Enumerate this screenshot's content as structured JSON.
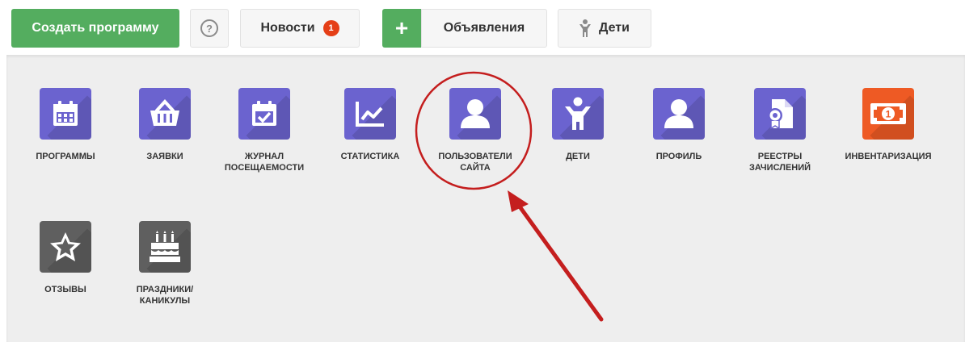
{
  "toolbar": {
    "create_program": "Создать программу",
    "help_glyph": "?",
    "news_label": "Новости",
    "news_badge": "1",
    "announcements_plus": "+",
    "announcements_label": "Объявления",
    "kids_label": "Дети"
  },
  "tiles": [
    {
      "label": "ПРОГРАММЫ",
      "icon": "calendar-icon",
      "color": "#6b63cf"
    },
    {
      "label": "ЗАЯВКИ",
      "icon": "basket-icon",
      "color": "#6b63cf"
    },
    {
      "label": "ЖУРНАЛ\nПОСЕЩАЕМОСТИ",
      "icon": "calendar-check-icon",
      "color": "#6b63cf"
    },
    {
      "label": "СТАТИСТИКА",
      "icon": "chart-icon",
      "color": "#6b63cf"
    },
    {
      "label": "ПОЛЬЗОВАТЕЛИ\nСАЙТА",
      "icon": "user-icon",
      "color": "#6b63cf"
    },
    {
      "label": "ДЕТИ",
      "icon": "child-icon",
      "color": "#6b63cf"
    },
    {
      "label": "ПРОФИЛЬ",
      "icon": "user-icon",
      "color": "#6b63cf"
    },
    {
      "label": "РЕЕСТРЫ\nЗАЧИСЛЕНИЙ",
      "icon": "certificate-icon",
      "color": "#6b63cf"
    },
    {
      "label": "ИНВЕНТАРИЗАЦИЯ",
      "icon": "money-icon",
      "color": "#ee5a24"
    },
    {
      "label": "ОТЗЫВЫ",
      "icon": "star-icon",
      "color": "#5f5f5f"
    },
    {
      "label": "ПРАЗДНИКИ/\nКАНИКУЛЫ",
      "icon": "birthday-cake-icon",
      "color": "#5f5f5f"
    }
  ],
  "annotation": {
    "color": "#c41e1e"
  }
}
